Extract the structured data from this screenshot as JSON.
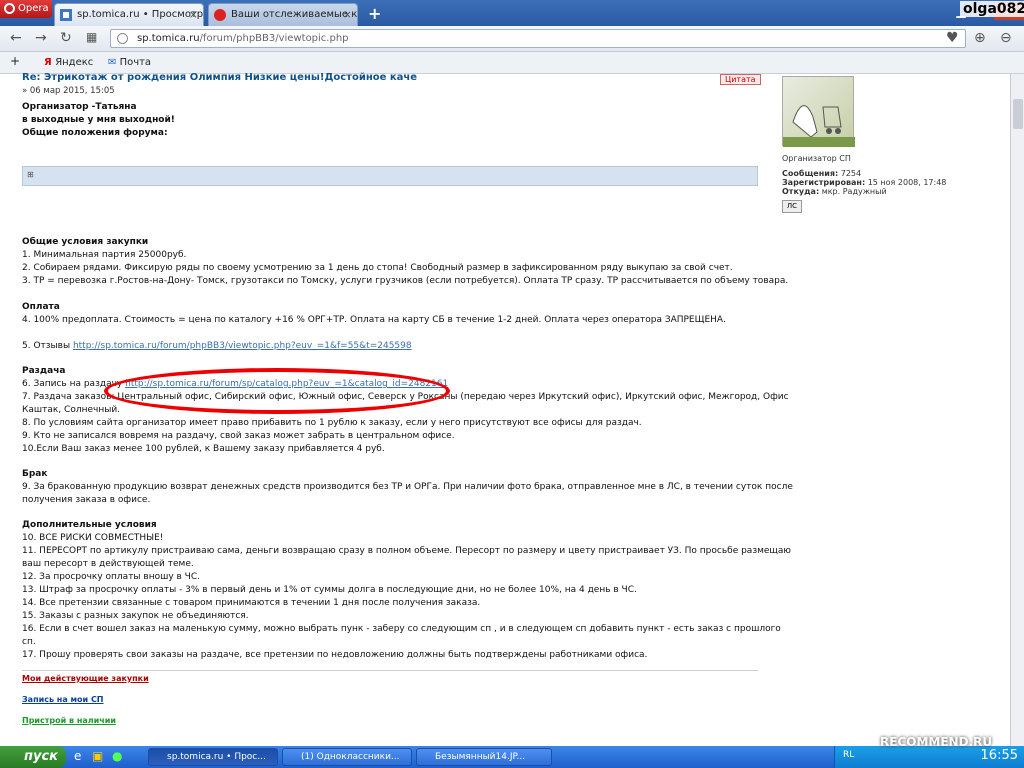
{
  "browser": {
    "menu_label": "Opera",
    "tabs": [
      {
        "label": "sp.tomica.ru • Просмотр те"
      },
      {
        "label": "Ваши отслеживаемые комм"
      }
    ],
    "user_label": "olga0822",
    "url_domain": "sp.tomica.ru",
    "url_path": "/forum/phpBB3/viewtopic.php",
    "bookmarks": [
      {
        "label": "Яндекс"
      },
      {
        "label": "Почта"
      }
    ]
  },
  "post": {
    "title": "Re: Этрикотаж от рождения Олимпия Низкие цены!Достойное каче",
    "meta": "» 06 мар 2015, 15:05",
    "reply_label": "Цитата",
    "organizer_line": "Организатор       -Татьяна",
    "weekend_line": "в выходные у мня выходной!",
    "general_rules": "Общие положения форума:",
    "sections": {
      "terms_header": "Общие условия закупки",
      "terms": [
        "1. Минимальная партия 25000руб.",
        "2. Собираем рядами. Фиксирую ряды по своему усмотрению за 1 день до стопа! Свободный размер в зафиксированном ряду выкупаю за свой счет.",
        "3. ТР = перевозка г.Ростов-на-Дону- Томск, грузотакси по Томску, услуги грузчиков (если потребуется). Оплата ТР сразу. ТР рассчитывается по объему товара."
      ],
      "payment_header": "Оплата",
      "payment": "4. 100% предоплата. Стоимость = цена по каталогу +16 % ОРГ+ТР. Оплата на карту СБ в течение 1-2 дней. Оплата через оператора ЗАПРЕЩЕНА.",
      "reviews_label": "5. Отзывы ",
      "reviews_link": "http://sp.tomica.ru/forum/phpBB3/viewtopic.php?euv_=1&f=55&t=245598",
      "delivery_header": "Раздача",
      "delivery_signup_label": "6. Запись на раздачу ",
      "delivery_signup_link": "http://sp.tomica.ru/forum/sp/catalog.php?euv_=1&catalog_id=2482161",
      "delivery": [
        "7. Раздача заказов: Центральный офис, Сибирский офис, Южный офис, Северск у Роксаны (передаю через Иркутский офис), Иркутский офис, Межгород, Офис",
        "Каштак, Солнечный.",
        "8. По условиям сайта организатор имеет право прибавить по 1 рублю к заказу, если у него присутствуют все офисы для раздач.",
        "9. Кто не записался вовремя на раздачу, свой заказ может забрать в центральном офисе.",
        "10.Если Ваш заказ менее 100 рублей, к Вашему заказу прибавляется 4 руб."
      ],
      "defect_header": "Брак",
      "defect": [
        "9. За бракованную продукцию возврат денежных средств производится без ТР и ОРГа. При наличии фото брака, отправленное мне в ЛС, в течении суток после",
        "получения заказа в офисе."
      ],
      "extra_header": "Дополнительные условия",
      "extra": [
        "10. ВСЕ РИСКИ СОВМЕСТНЫЕ!",
        "11. ПЕРЕСОРТ по артикулу пристраиваю сама, деньги возвращаю сразу в полном объеме. Пересорт по размеру и цвету пристраивает УЗ. По просьбе размещаю",
        "ваш пересорт в действующей теме.",
        "12. За просрочку оплаты вношу в ЧС.",
        "13. Штраф за просрочку оплаты - 3% в первый день и 1% от суммы долга в последующие дни, но не более 10%, на 4 день в ЧС.",
        "14. Все претензии связанные с товаром принимаются в течении 1 дня после получения заказа.",
        "15. Заказы с разных закупок не объединяются.",
        "16. Если в счет вошел заказ на маленькую сумму, можно выбрать пунк - заберу со следующим сп , и в следующем сп добавить пункт - есть заказ с прошлого",
        "сп.",
        "17. Прошу проверять свои заказы на раздаче, все претензии по недовложению должны быть подтверждены работниками офиса."
      ],
      "links": {
        "my_purchases": "Мои действующие закупки",
        "signup": "Запись на мои СП",
        "attach": "Пристрой в наличии"
      }
    }
  },
  "profile": {
    "role": "Организатор СП",
    "messages_label": "Сообщения:",
    "messages_value": "7254",
    "registered_label": "Зарегистрирован:",
    "registered_value": "15 ноя 2008, 17:48",
    "from_label": "Откуда:",
    "from_value": "мкр. Радужный",
    "pm_label": "ЛС"
  },
  "taskbar": {
    "start_label": "пуск",
    "tasks": [
      {
        "label": "sp.tomica.ru • Прос..."
      },
      {
        "label": "(1) Одноклассники..."
      },
      {
        "label": "Безымянный14.JP..."
      }
    ],
    "lang": "RL",
    "clock": "16:55"
  },
  "watermark": "RECOMMEND.RU"
}
